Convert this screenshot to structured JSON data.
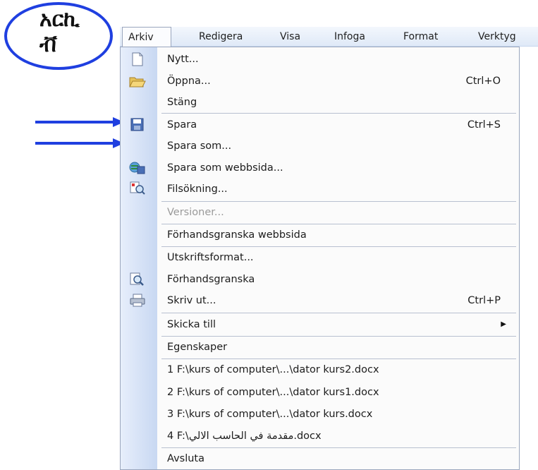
{
  "annotation": {
    "badge_text_line1": "አርኪ",
    "badge_text_line2": "ቭ",
    "color": "#1f3fe0"
  },
  "menubar": {
    "items": [
      "Arkiv",
      "Redigera",
      "Visa",
      "Infoga",
      "Format",
      "Verktyg"
    ]
  },
  "menu": {
    "items": [
      {
        "label": "Nytt...",
        "icon": "new-document-icon"
      },
      {
        "label": "Öppna...",
        "shortcut": "Ctrl+O",
        "icon": "open-folder-icon"
      },
      {
        "label": "Stäng"
      },
      {
        "label": "Spara",
        "shortcut": "Ctrl+S",
        "icon": "save-disk-icon"
      },
      {
        "label": "Spara som..."
      },
      {
        "label": "Spara som webbsida...",
        "icon": "save-web-icon"
      },
      {
        "label": "Filsökning...",
        "icon": "file-search-icon"
      },
      {
        "label": "Versioner...",
        "disabled": true
      },
      {
        "label": "Förhandsgranska webbsida"
      },
      {
        "label": "Utskriftsformat..."
      },
      {
        "label": "Förhandsgranska",
        "icon": "print-preview-icon"
      },
      {
        "label": "Skriv ut...",
        "shortcut": "Ctrl+P",
        "icon": "printer-icon"
      },
      {
        "label": "Skicka till",
        "submenu": true
      },
      {
        "label": "Egenskaper"
      },
      {
        "label": "1 F:\\kurs of computer\\...\\dator kurs2.docx"
      },
      {
        "label": "2 F:\\kurs of computer\\...\\dator kurs1.docx"
      },
      {
        "label": "3 F:\\kurs of computer\\...\\dator kurs.docx"
      },
      {
        "label": "4 F:\\مقدمة في الحاسب الالي.docx"
      },
      {
        "label": "Avsluta"
      }
    ],
    "submenu_arrow": "▶"
  }
}
